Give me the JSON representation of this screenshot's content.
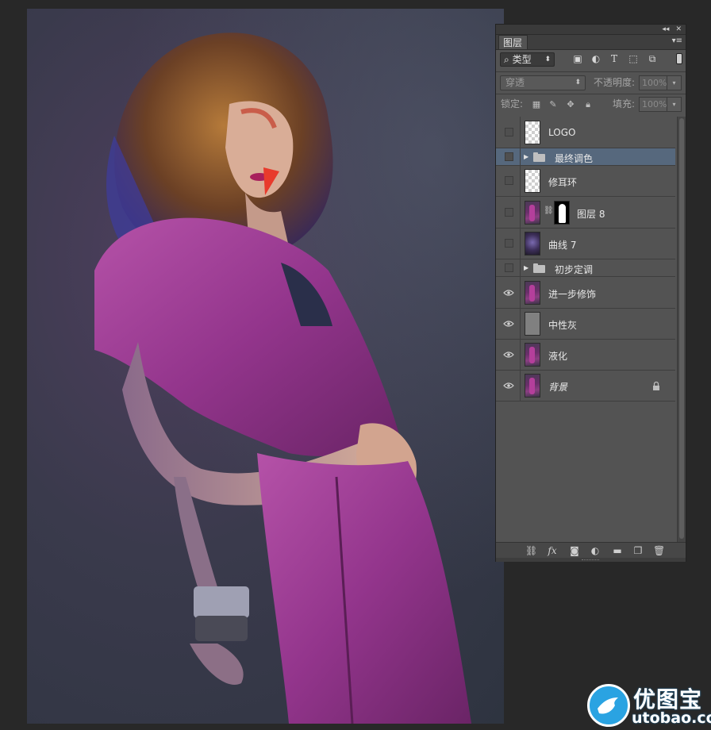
{
  "panel": {
    "collapse_glyph": "◂◂",
    "close_glyph": "✕",
    "tab_label": "图层",
    "menu_glyph": "▾≡",
    "filter": {
      "kind_label": "类型",
      "search_glyph": "⌕"
    },
    "blend": {
      "mode": "穿透",
      "opacity_label": "不透明度:",
      "opacity_value": "100%"
    },
    "lock": {
      "label": "锁定:",
      "fill_label": "填充:",
      "fill_value": "100%"
    },
    "layers": [
      {
        "name": "LOGO",
        "visible": false,
        "thumb": "transparent",
        "selected": false,
        "group": false
      },
      {
        "name": "最终调色",
        "visible": false,
        "thumb": "folder",
        "selected": true,
        "group": true
      },
      {
        "name": "修耳环",
        "visible": false,
        "thumb": "transparent",
        "selected": false,
        "group": false
      },
      {
        "name": "图层 8",
        "visible": false,
        "thumb": "photo+mask",
        "selected": false,
        "group": false
      },
      {
        "name": "曲线 7",
        "visible": false,
        "thumb": "curves",
        "selected": false,
        "group": false
      },
      {
        "name": "初步定调",
        "visible": false,
        "thumb": "folder",
        "selected": false,
        "group": true
      },
      {
        "name": "进一步修饰",
        "visible": true,
        "thumb": "photo",
        "selected": false,
        "group": false
      },
      {
        "name": "中性灰",
        "visible": true,
        "thumb": "gray",
        "selected": false,
        "group": false
      },
      {
        "name": "液化",
        "visible": true,
        "thumb": "photo",
        "selected": false,
        "group": false
      },
      {
        "name": "背景",
        "visible": true,
        "thumb": "photo",
        "selected": false,
        "group": false,
        "locked": true
      }
    ]
  },
  "watermark": {
    "cn": "优图宝",
    "en": "utobao.com",
    "color": "#2aa3e2"
  }
}
